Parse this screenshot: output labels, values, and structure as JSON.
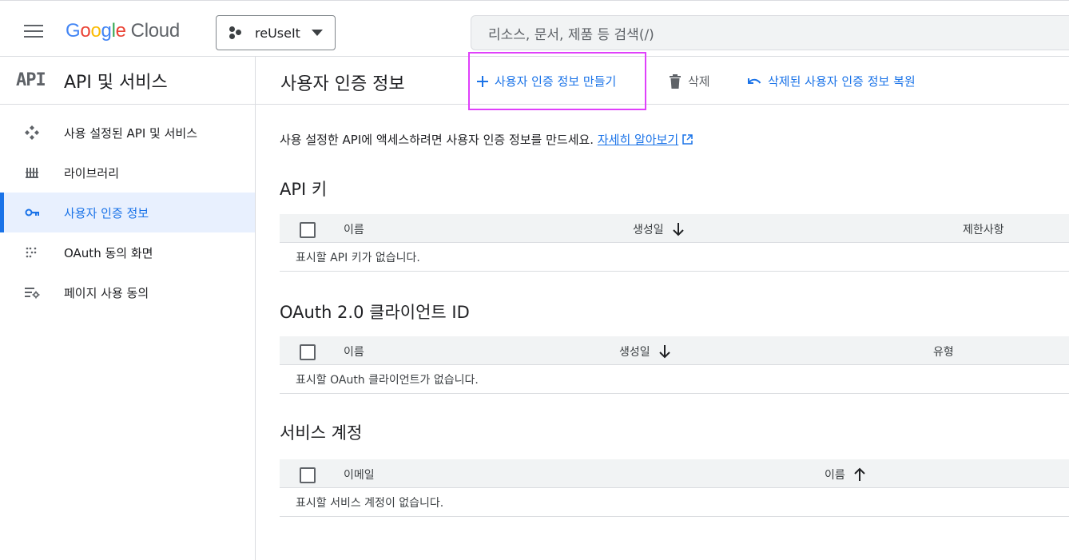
{
  "topbar": {
    "logo_google": [
      "G",
      "o",
      "o",
      "g",
      "l",
      "e"
    ],
    "logo_cloud": "Cloud",
    "project_name": "reUseIt",
    "search_placeholder": "리소스, 문서, 제품 등 검색(/)"
  },
  "sidebar": {
    "api_mark": "API",
    "title": "API 및 서비스",
    "items": [
      {
        "label": "사용 설정된 API 및 서비스",
        "icon": "enabled-apis-icon"
      },
      {
        "label": "라이브러리",
        "icon": "library-icon"
      },
      {
        "label": "사용자 인증 정보",
        "icon": "key-icon",
        "active": true
      },
      {
        "label": "OAuth 동의 화면",
        "icon": "oauth-consent-icon"
      },
      {
        "label": "페이지 사용 동의",
        "icon": "page-agreement-icon"
      }
    ]
  },
  "main": {
    "page_title": "사용자 인증 정보",
    "actions": {
      "create": "사용자 인증 정보 만들기",
      "delete": "삭제",
      "restore": "삭제된 사용자 인증 정보 복원"
    },
    "intro_text": "사용 설정한 API에 액세스하려면 사용자 인증 정보를 만드세요.",
    "learn_more": "자세히 알아보기",
    "api_keys": {
      "title": "API 키",
      "col_name": "이름",
      "col_created": "생성일",
      "col_restrictions": "제한사항",
      "empty": "표시할 API 키가 없습니다."
    },
    "oauth_clients": {
      "title": "OAuth 2.0 클라이언트 ID",
      "col_name": "이름",
      "col_created": "생성일",
      "col_type": "유형",
      "empty": "표시할 OAuth 클라이언트가 없습니다."
    },
    "service_accounts": {
      "title": "서비스 계정",
      "col_email": "이메일",
      "col_name": "이름",
      "empty": "표시할 서비스 계정이 없습니다."
    }
  },
  "colors": {
    "accent": "#1a73e8",
    "highlight": "#e040fb",
    "active_bg": "#e8f0fe"
  }
}
